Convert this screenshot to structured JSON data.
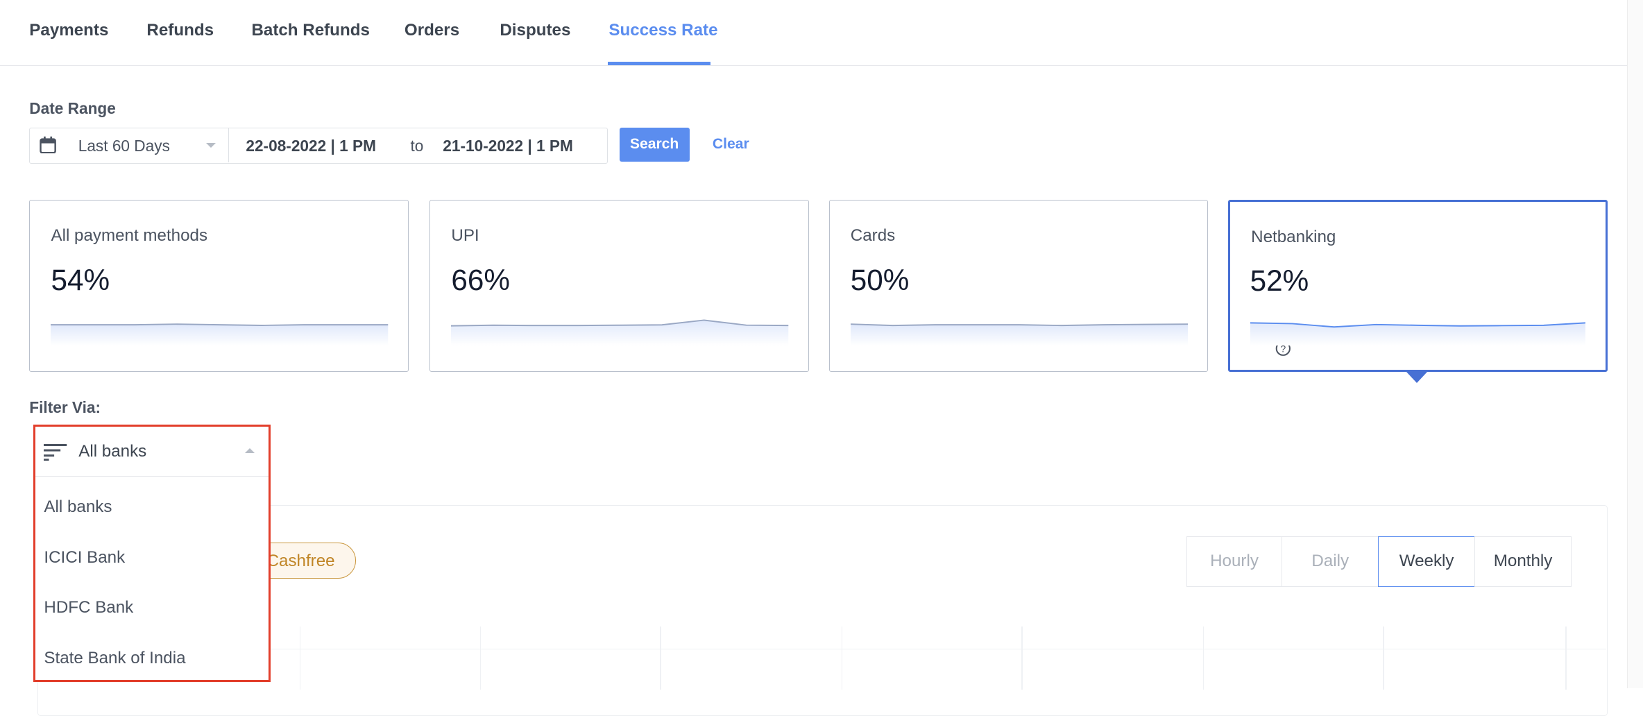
{
  "tabs": [
    {
      "label": "Payments"
    },
    {
      "label": "Refunds"
    },
    {
      "label": "Batch Refunds"
    },
    {
      "label": "Orders"
    },
    {
      "label": "Disputes"
    },
    {
      "label": "Success Rate",
      "active": true
    }
  ],
  "date_range": {
    "label": "Date Range",
    "preset": "Last 60 Days",
    "from": "22-08-2022 | 1 PM",
    "to_label": "to",
    "to": "21-10-2022 | 1 PM",
    "search_label": "Search",
    "clear_label": "Clear"
  },
  "cards": [
    {
      "title": "All payment methods",
      "value": "54%",
      "trend": [
        54,
        54,
        54,
        54.2,
        54,
        53.8,
        54,
        54,
        54
      ]
    },
    {
      "title": "UPI",
      "value": "66%",
      "trend": [
        65.8,
        66,
        65.9,
        65.9,
        66,
        66.1,
        67.5,
        66,
        65.9
      ]
    },
    {
      "title": "Cards",
      "value": "50%",
      "trend": [
        50,
        49.6,
        49.8,
        49.8,
        49.8,
        49.6,
        49.8,
        49.9,
        50
      ]
    },
    {
      "title": "Netbanking",
      "value": "52%",
      "selected": true,
      "help_icon": "question-circle-icon",
      "trend": [
        52.2,
        52,
        51,
        51.7,
        51.5,
        51.3,
        51.4,
        51.5,
        52.2
      ]
    }
  ],
  "filter": {
    "label": "Filter Via:",
    "selected": "All banks",
    "icon": "filter-lines-icon",
    "options": [
      "All banks",
      "ICICI Bank",
      "HDFC Bank",
      "State Bank of India"
    ]
  },
  "chart": {
    "pill": "Cashfree",
    "granularity": [
      "Hourly",
      "Daily",
      "Weekly",
      "Monthly"
    ],
    "selected_granularity": "Weekly"
  },
  "colors": {
    "accent": "#5b8def",
    "selected_border": "#4770d4",
    "highlight": "#e23e2b",
    "pill": "#c08526"
  }
}
